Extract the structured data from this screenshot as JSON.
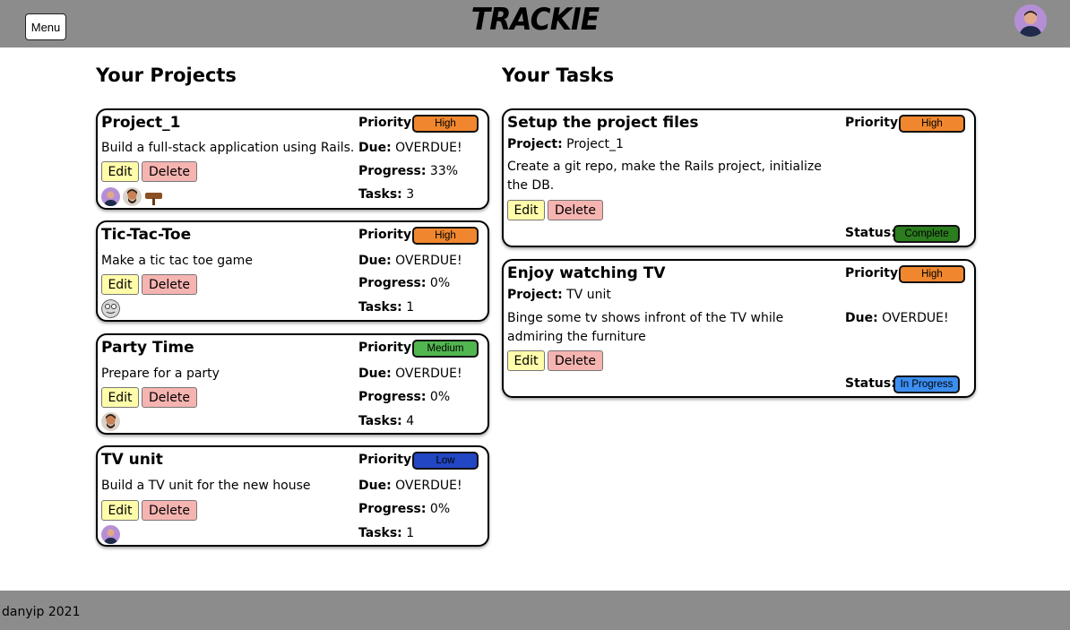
{
  "header": {
    "menu_label": "Menu",
    "brand": "TRACKIE",
    "avatar_icon": "user-avatar-icon"
  },
  "sections": {
    "projects_title": "Your Projects",
    "tasks_title": "Your Tasks"
  },
  "labels": {
    "priority": "Priority:",
    "due": "Due:",
    "progress": "Progress:",
    "tasks": "Tasks:",
    "project": "Project:",
    "status": "Status:",
    "edit": "Edit",
    "delete": "Delete"
  },
  "colors": {
    "high": "#f0872e",
    "medium": "#52b650",
    "low": "#2246c4",
    "complete": "#2c7d1f",
    "in_progress": "#3c8ef0"
  },
  "projects": [
    {
      "title": "Project_1",
      "description": "Build a full-stack application using Rails.",
      "priority": "High",
      "due": "OVERDUE!",
      "progress": "33%",
      "tasks": "3",
      "assignees": [
        "user-avatar-icon",
        "user-avatar-icon",
        "wooden-sign-icon"
      ]
    },
    {
      "title": "Tic-Tac-Toe",
      "description": "Make a tic tac toe game",
      "priority": "High",
      "due": "OVERDUE!",
      "progress": "0%",
      "tasks": "1",
      "assignees": [
        "face-avatar-icon"
      ]
    },
    {
      "title": "Party Time",
      "description": "Prepare for a party",
      "priority": "Medium",
      "due": "OVERDUE!",
      "progress": "0%",
      "tasks": "4",
      "assignees": [
        "user-avatar-icon"
      ]
    },
    {
      "title": "TV unit",
      "description": "Build a TV unit for the new house",
      "priority": "Low",
      "due": "OVERDUE!",
      "progress": "0%",
      "tasks": "1",
      "assignees": [
        "user-avatar-icon"
      ]
    }
  ],
  "tasks": [
    {
      "title": "Setup the project files",
      "project": "Project_1",
      "description": "Create a git repo, make the Rails project, initialize the DB.",
      "priority": "High",
      "due": "",
      "status": "Complete"
    },
    {
      "title": "Enjoy watching TV",
      "project": "TV unit",
      "description": "Binge some tv shows infront of the TV while admiring the furniture",
      "priority": "High",
      "due": "OVERDUE!",
      "status": "In Progress"
    }
  ],
  "footer": {
    "text": "danyip 2021"
  }
}
